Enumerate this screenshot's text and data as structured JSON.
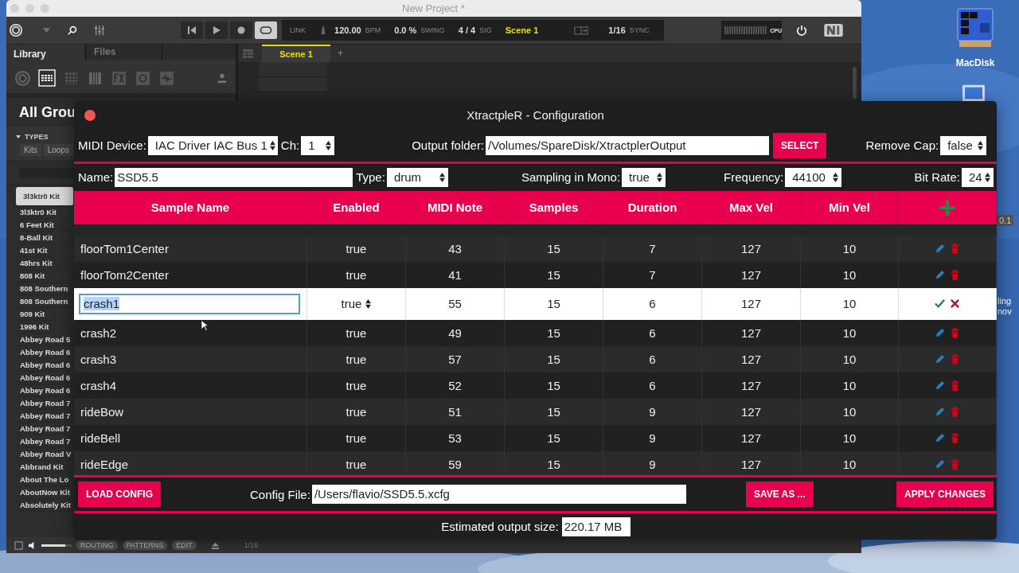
{
  "desktop": {
    "icon_label": "MacDisk",
    "fragment": "0.1",
    "partial_label_lines": [
      "ling",
      "nov"
    ]
  },
  "maschine": {
    "title": "New Project *",
    "toolbar": {
      "link": "LINK",
      "bpm": "120.00",
      "bpm_label": "BPM",
      "swing": "0.0 %",
      "swing_label": "SWING",
      "sig": "4 / 4",
      "sig_label": "SIG",
      "scene": "Scene 1",
      "grid": "1/16",
      "sync_label": "SYNC",
      "cpu_label": "CPU"
    },
    "browser": {
      "tabs": [
        {
          "label": "Library",
          "selected": true
        },
        {
          "label": "Files",
          "selected": false
        }
      ],
      "header": "All Grou",
      "types_label": "TYPES",
      "type_tabs": [
        "Kits",
        "Loops"
      ],
      "items": [
        {
          "label": "3l3ktr0 Kit",
          "selected": true
        },
        {
          "label": "3l3ktr0 Kit",
          "selected": false
        },
        {
          "label": "6 Feet Kit",
          "selected": false
        },
        {
          "label": "8-Ball Kit",
          "selected": false
        },
        {
          "label": "41st Kit",
          "selected": false
        },
        {
          "label": "48hrs Kit",
          "selected": false
        },
        {
          "label": "808 Kit",
          "selected": false
        },
        {
          "label": "808 Southern",
          "selected": false
        },
        {
          "label": "808 Southern",
          "selected": false
        },
        {
          "label": "909 Kit",
          "selected": false
        },
        {
          "label": "1996 Kit",
          "selected": false
        },
        {
          "label": "Abbey Road 5",
          "selected": false
        },
        {
          "label": "Abbey Road 6",
          "selected": false
        },
        {
          "label": "Abbey Road 6",
          "selected": false
        },
        {
          "label": "Abbey Road 6",
          "selected": false
        },
        {
          "label": "Abbey Road 6",
          "selected": false
        },
        {
          "label": "Abbey Road 7",
          "selected": false
        },
        {
          "label": "Abbey Road 7",
          "selected": false
        },
        {
          "label": "Abbey Road 7",
          "selected": false
        },
        {
          "label": "Abbey Road 7",
          "selected": false
        },
        {
          "label": "Abbey Road V",
          "selected": false
        },
        {
          "label": "Abbrand Kit",
          "selected": false
        },
        {
          "label": "About The Lo",
          "selected": false
        },
        {
          "label": "AboutNow Kit",
          "selected": false
        },
        {
          "label": "Absolutely Kit",
          "selected": false
        }
      ]
    },
    "arranger": {
      "scene_tab": "Scene 1",
      "add": "+"
    },
    "bottom_bar": {
      "volume": {
        "level": 0.8
      },
      "buttons": [
        "ROUTING",
        "PATTERNS",
        "EDIT"
      ],
      "grid": "1/16"
    }
  },
  "config": {
    "title": "XtractpleR - Configuration",
    "midi_device": {
      "label": "MIDI Device:",
      "value": "IAC Driver IAC Bus 1"
    },
    "channel": {
      "label": "Ch:",
      "value": "1"
    },
    "output_folder": {
      "label": "Output folder:",
      "value": "/Volumes/SpareDisk/XtractplerOutput"
    },
    "select_button": "SELECT",
    "remove_cap": {
      "label": "Remove Cap:",
      "value": "false"
    },
    "name": {
      "label": "Name:",
      "value": "SSD5.5"
    },
    "type": {
      "label": "Type:",
      "value": "drum"
    },
    "mono": {
      "label": "Sampling in Mono:",
      "value": "true"
    },
    "frequency": {
      "label": "Frequency:",
      "value": "44100"
    },
    "bit_rate": {
      "label": "Bit Rate:",
      "value": "24"
    },
    "table": {
      "columns": [
        "Sample Name",
        "Enabled",
        "MIDI Note",
        "Samples",
        "Duration",
        "Max Vel",
        "Min Vel"
      ],
      "rows": [
        {
          "name": "floorTom1Center",
          "enabled": "true",
          "midi_note": "43",
          "samples": "15",
          "duration": "7",
          "max_vel": "127",
          "min_vel": "10",
          "editing": false
        },
        {
          "name": "floorTom2Center",
          "enabled": "true",
          "midi_note": "41",
          "samples": "15",
          "duration": "7",
          "max_vel": "127",
          "min_vel": "10",
          "editing": false
        },
        {
          "name": "crash1",
          "enabled": "true",
          "midi_note": "55",
          "samples": "15",
          "duration": "6",
          "max_vel": "127",
          "min_vel": "10",
          "editing": true
        },
        {
          "name": "crash2",
          "enabled": "true",
          "midi_note": "49",
          "samples": "15",
          "duration": "6",
          "max_vel": "127",
          "min_vel": "10",
          "editing": false
        },
        {
          "name": "crash3",
          "enabled": "true",
          "midi_note": "57",
          "samples": "15",
          "duration": "6",
          "max_vel": "127",
          "min_vel": "10",
          "editing": false
        },
        {
          "name": "crash4",
          "enabled": "true",
          "midi_note": "52",
          "samples": "15",
          "duration": "6",
          "max_vel": "127",
          "min_vel": "10",
          "editing": false
        },
        {
          "name": "rideBow",
          "enabled": "true",
          "midi_note": "51",
          "samples": "15",
          "duration": "9",
          "max_vel": "127",
          "min_vel": "10",
          "editing": false
        },
        {
          "name": "rideBell",
          "enabled": "true",
          "midi_note": "53",
          "samples": "15",
          "duration": "9",
          "max_vel": "127",
          "min_vel": "10",
          "editing": false
        },
        {
          "name": "rideEdge",
          "enabled": "true",
          "midi_note": "59",
          "samples": "15",
          "duration": "9",
          "max_vel": "127",
          "min_vel": "10",
          "editing": false
        }
      ]
    },
    "load_button": "LOAD CONFIG",
    "config_file": {
      "label": "Config File:",
      "value": "/Users/flavio/SSD5.5.xcfg"
    },
    "save_button": "SAVE AS ...",
    "apply_button": "APPLY CHANGES",
    "estimate": {
      "label": "Estimated output size:",
      "value": "220.17 MB"
    }
  }
}
